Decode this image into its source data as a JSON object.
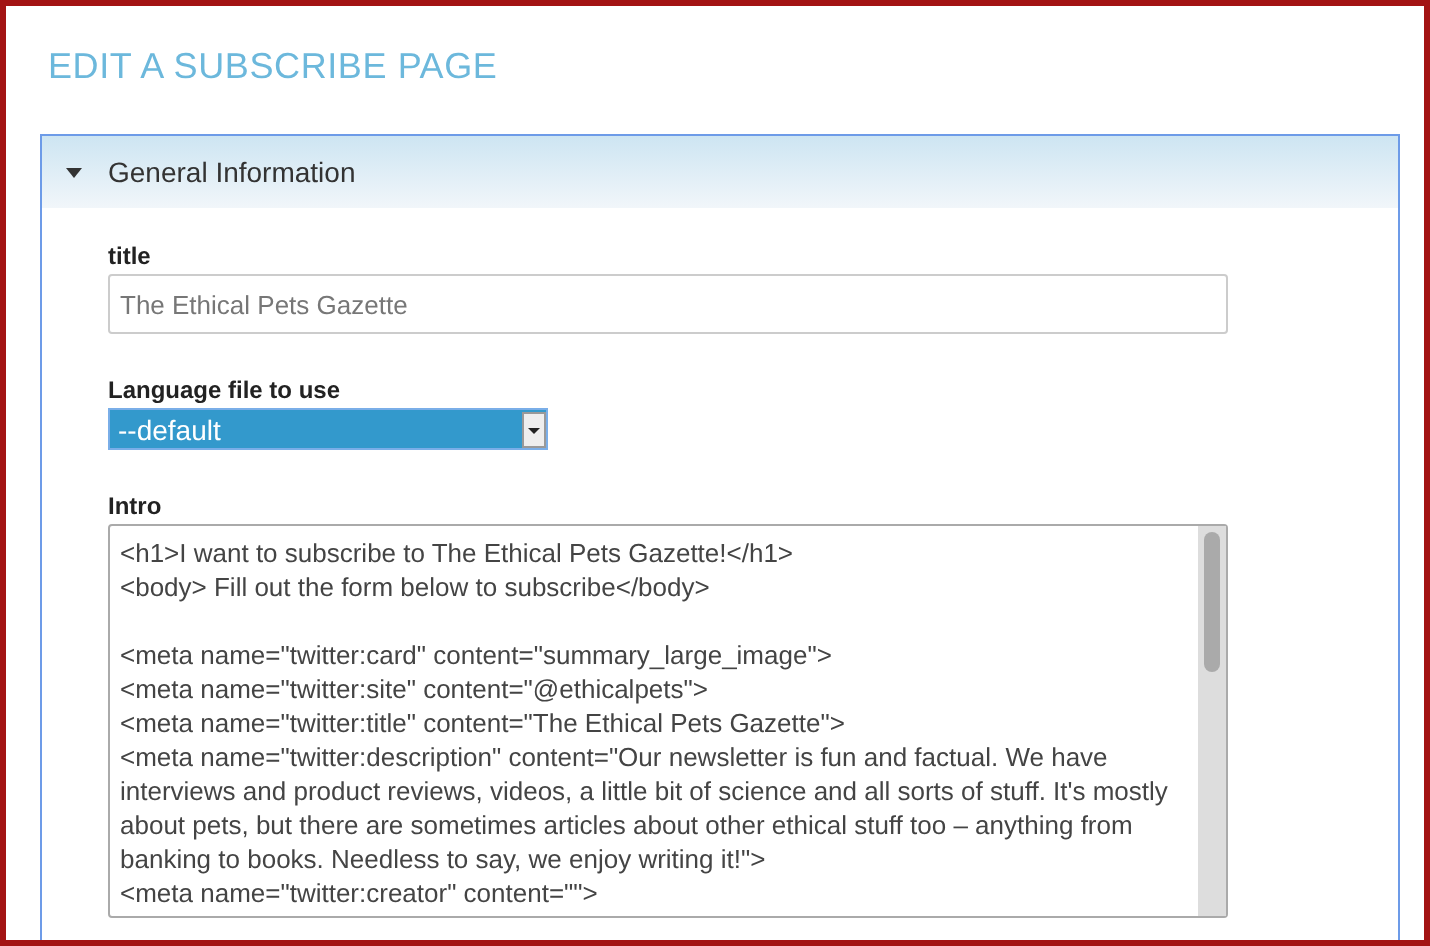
{
  "page_title": "EDIT A SUBSCRIBE PAGE",
  "panel": {
    "title": "General Information",
    "expanded": true,
    "fields": [
      {
        "kind": "text",
        "label": "title",
        "value": "The Ethical Pets Gazette"
      },
      {
        "kind": "select",
        "label": "Language file to use",
        "value": "--default"
      },
      {
        "kind": "textarea",
        "label": "Intro",
        "blocks": [
          [
            "<h1>I want to subscribe to The Ethical Pets Gazette!</h1>",
            "<body> Fill out the form below to subscribe</body>"
          ],
          [
            "<meta name=\"twitter:card\" content=\"summary_large_image\">",
            "<meta name=\"twitter:site\" content=\"@ethicalpets\">",
            "<meta name=\"twitter:title\" content=\"The Ethical Pets Gazette\">",
            "<meta name=\"twitter:description\" content=\"Our newsletter is fun and factual. We have interviews and product reviews, videos, a little bit of science and all sorts of stuff. It's mostly about pets, but there are sometimes articles about other ethical stuff too – anything from banking to books. Needless to say, we enjoy writing it!\">",
            "<meta name=\"twitter:creator\" content=\"\">"
          ]
        ]
      }
    ]
  }
}
